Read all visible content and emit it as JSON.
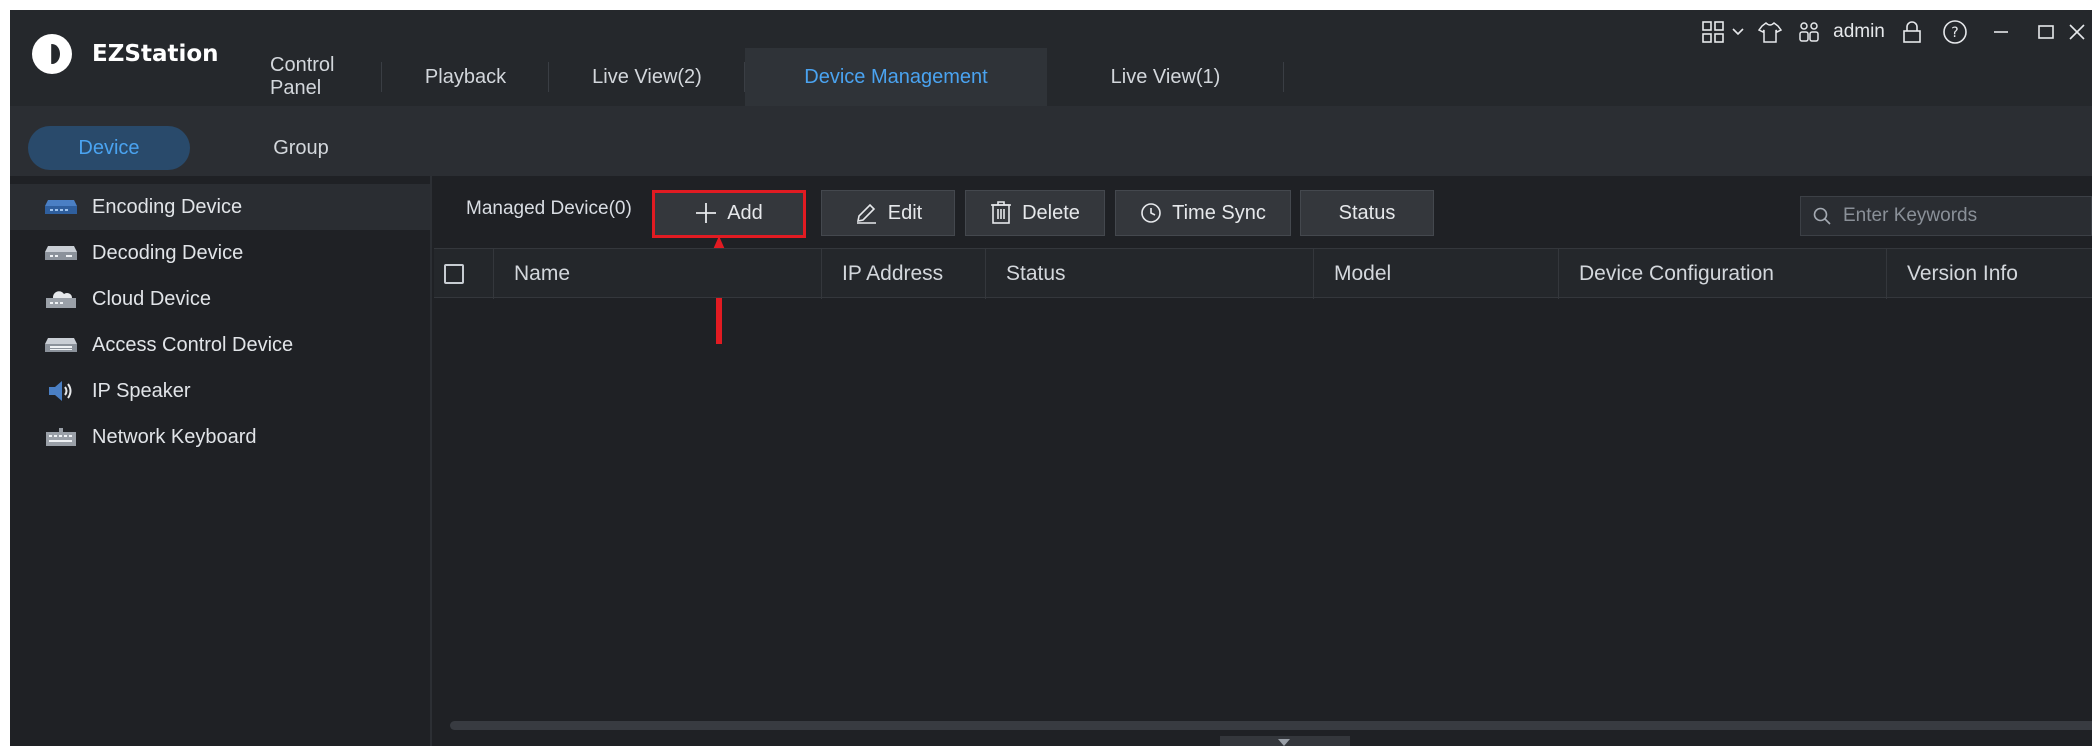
{
  "app": {
    "name": "EZStation"
  },
  "tabs": [
    {
      "label": "Control Panel",
      "active": false
    },
    {
      "label": "Playback",
      "active": false
    },
    {
      "label": "Live View(2)",
      "active": false
    },
    {
      "label": "Device Management",
      "active": true
    },
    {
      "label": "Live View(1)",
      "active": false
    }
  ],
  "tray": {
    "user": "admin",
    "icons": [
      "layout-grid-icon",
      "chevron-down-icon",
      "skin-shirt-icon",
      "users-icon",
      "lock-icon",
      "help-icon",
      "minimize-icon",
      "maximize-icon",
      "close-icon"
    ]
  },
  "subnav": {
    "device_label": "Device",
    "group_label": "Group",
    "active": "Device"
  },
  "sidebar": {
    "items": [
      {
        "label": "Encoding Device",
        "icon": "encoding-device-icon",
        "active": true
      },
      {
        "label": "Decoding Device",
        "icon": "decoding-device-icon",
        "active": false
      },
      {
        "label": "Cloud Device",
        "icon": "cloud-device-icon",
        "active": false
      },
      {
        "label": "Access Control Device",
        "icon": "access-control-icon",
        "active": false
      },
      {
        "label": "IP Speaker",
        "icon": "speaker-icon",
        "active": false
      },
      {
        "label": "Network Keyboard",
        "icon": "keyboard-icon",
        "active": false
      }
    ]
  },
  "toolbar": {
    "managed_label": "Managed Device(0)",
    "add_label": "Add",
    "edit_label": "Edit",
    "delete_label": "Delete",
    "timesync_label": "Time Sync",
    "status_label": "Status"
  },
  "search": {
    "placeholder": "Enter Keywords",
    "value": ""
  },
  "table": {
    "columns": [
      "Name",
      "IP Address",
      "Status",
      "Model",
      "Device Configuration",
      "Version Info"
    ],
    "rows": []
  },
  "colors": {
    "accent": "#4aa3f0",
    "highlight": "#e11b22",
    "background": "#1f2125"
  }
}
